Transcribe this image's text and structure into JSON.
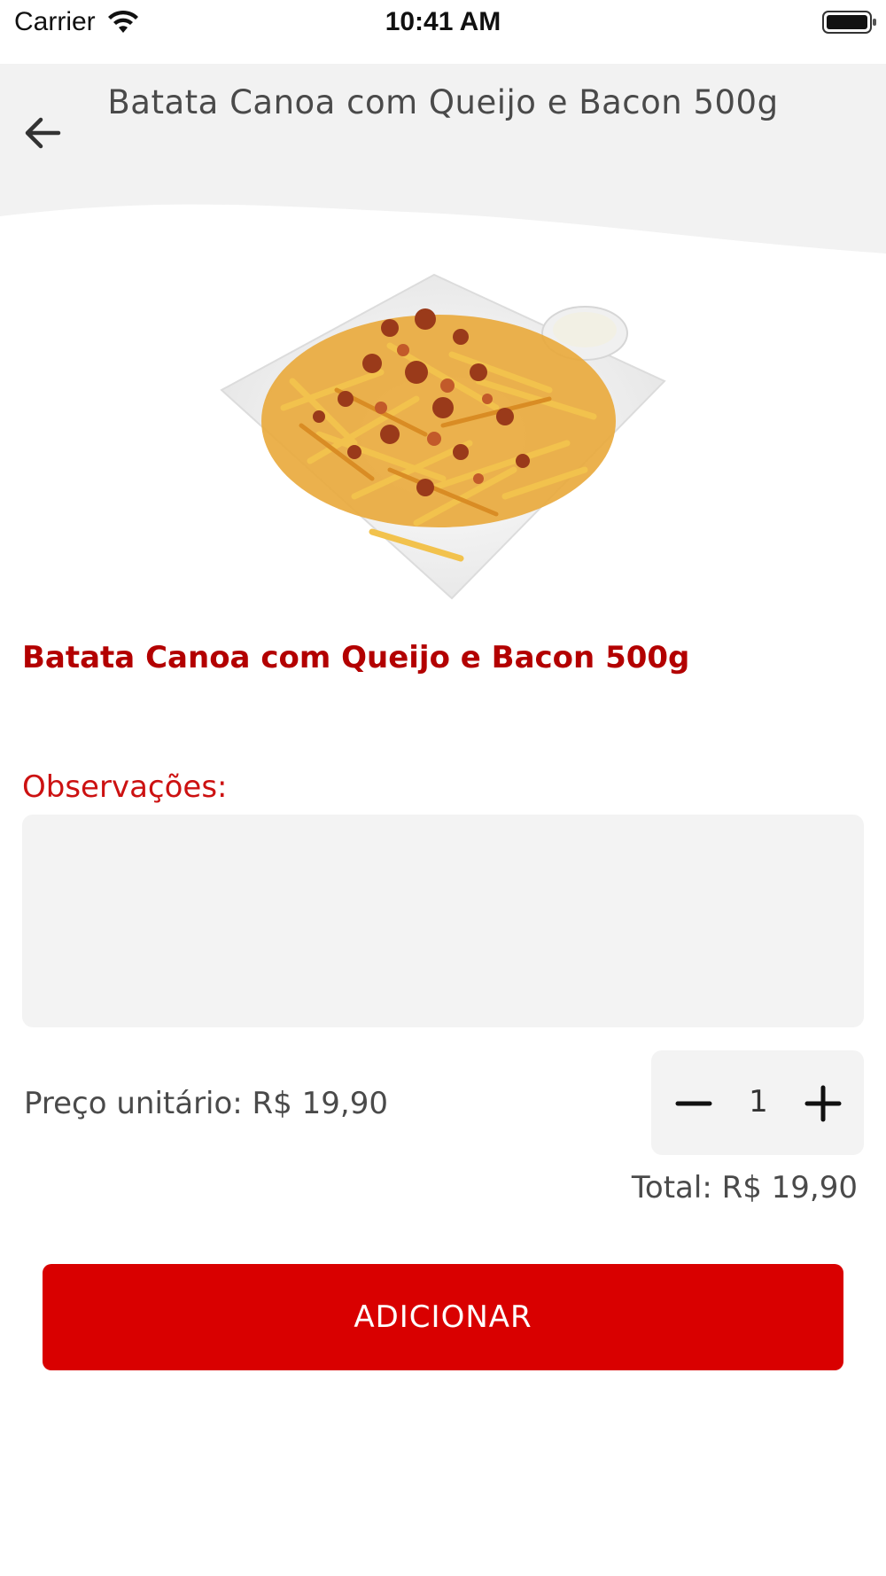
{
  "status_bar": {
    "carrier": "Carrier",
    "time": "10:41 AM",
    "wifi_icon": "wifi-icon",
    "battery_icon": "battery-icon"
  },
  "header": {
    "title": "Batata Canoa com Queijo e Bacon 500g",
    "back_icon": "arrow-left-icon"
  },
  "product": {
    "name": "Batata Canoa com Queijo e Bacon 500g",
    "image_description": "plate of fries with bacon and cheese"
  },
  "observations": {
    "label": "Observações:",
    "value": "",
    "placeholder": ""
  },
  "pricing": {
    "unit_price": "Preço unitário: R$ 19,90",
    "quantity": "1",
    "total": "Total: R$ 19,90"
  },
  "actions": {
    "add_label": "ADICIONAR"
  },
  "colors": {
    "accent_red": "#d90000",
    "title_red": "#b30000",
    "field_bg": "#f3f3f3"
  }
}
